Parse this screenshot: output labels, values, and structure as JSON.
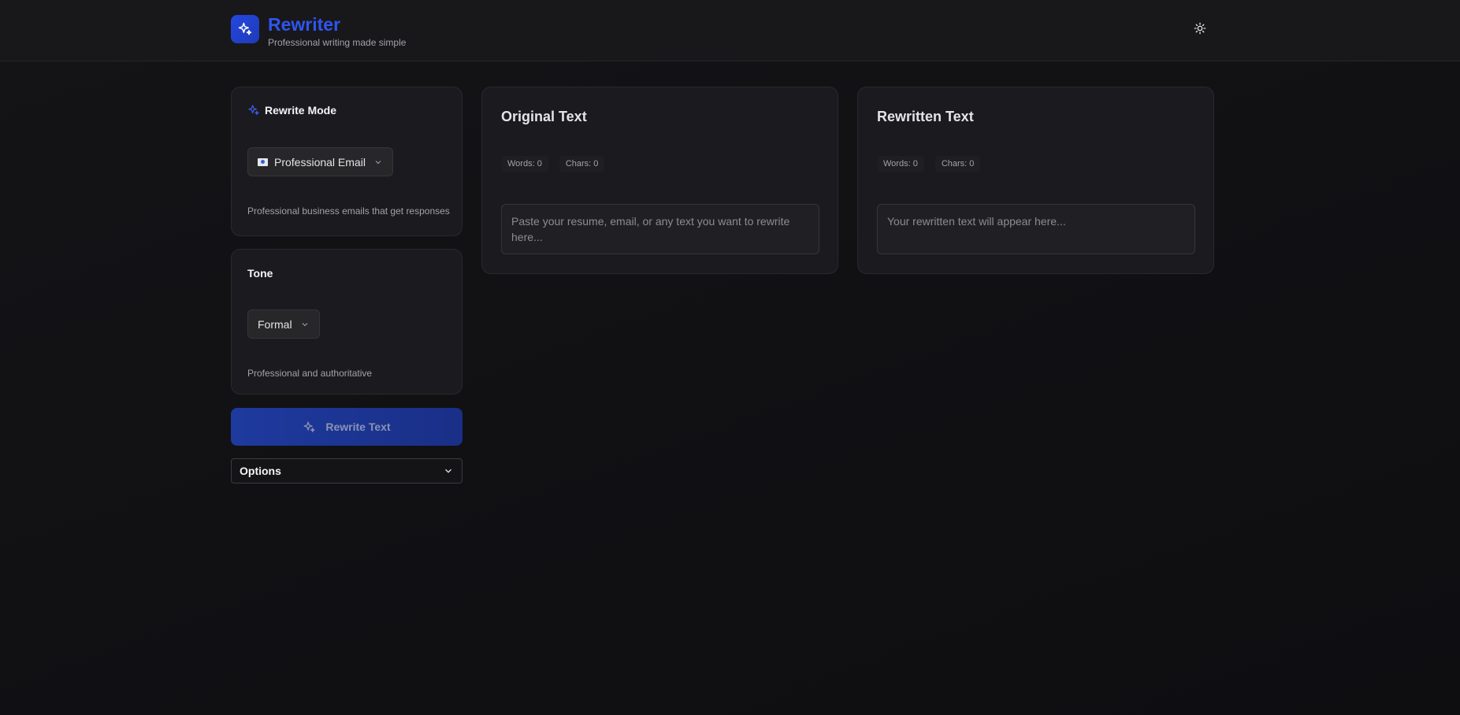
{
  "header": {
    "title": "Rewriter",
    "subtitle": "Professional writing made simple"
  },
  "icons": {
    "logo": "sparkles-icon",
    "theme_toggle": "sun-icon",
    "mode": "sparkles-icon",
    "chevron": "chevron-down-icon"
  },
  "mode_card": {
    "title": "Rewrite Mode",
    "selected": "Professional Email",
    "description": "Professional business emails that get responses"
  },
  "tone_card": {
    "title": "Tone",
    "selected": "Formal",
    "description": "Professional and authoritative"
  },
  "rewrite_button": {
    "label": "Rewrite Text"
  },
  "options": {
    "label": "Options"
  },
  "original": {
    "title": "Original Text",
    "words": "Words: 0",
    "chars": "Chars: 0",
    "placeholder": "Paste your resume, email, or any text you want to rewrite here...",
    "value": ""
  },
  "rewritten": {
    "title": "Rewritten Text",
    "words": "Words: 0",
    "chars": "Chars: 0",
    "placeholder": "Your rewritten text will appear here...",
    "value": ""
  },
  "colors": {
    "accent": "#2e55f0",
    "background": "#0f0f12",
    "card": "#1b1b1f",
    "button": "#1e3a9e"
  }
}
